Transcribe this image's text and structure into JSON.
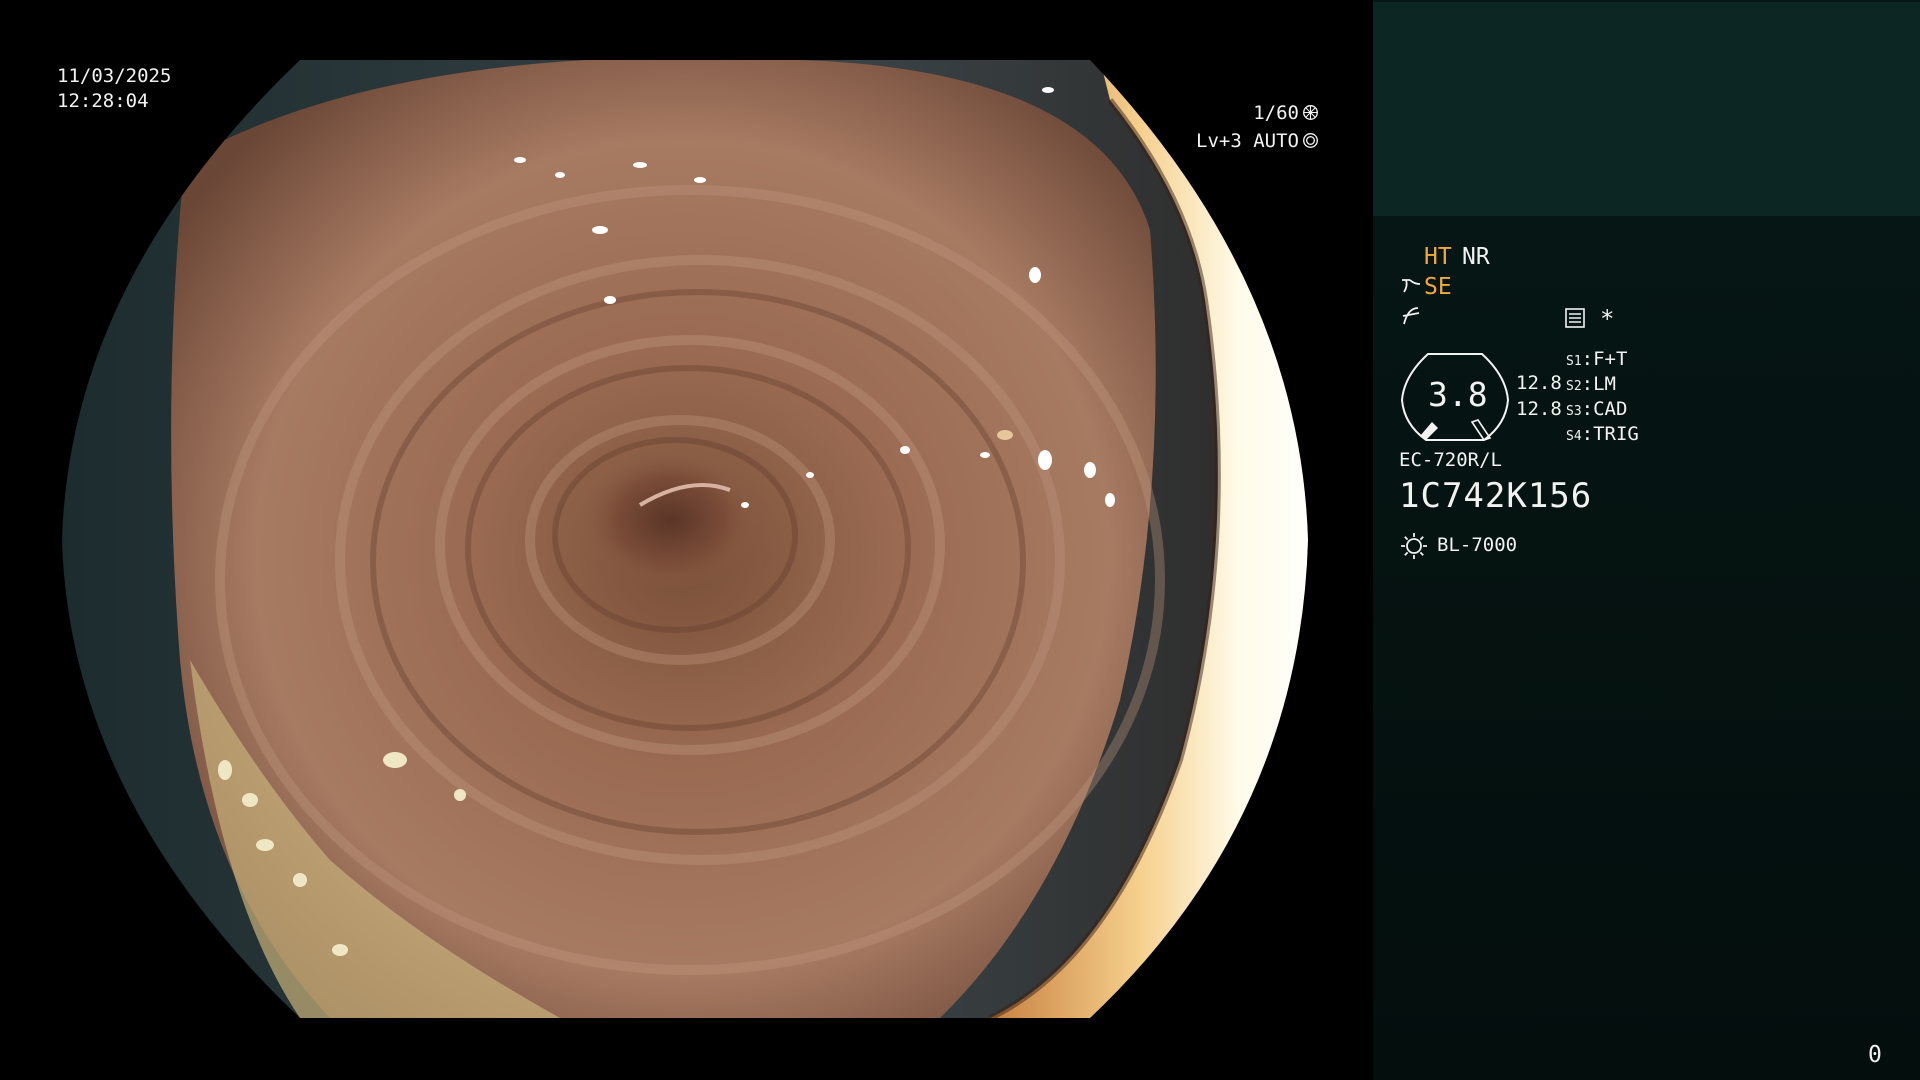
{
  "overlay": {
    "date": "11/03/2025",
    "time": "12:28:04",
    "shutter": "1/60",
    "level": "Lv+3 AUTO",
    "shutter_icon": "aperture-icon",
    "auto_icon": "iris-icon"
  },
  "panel": {
    "ht": "HT",
    "nr": "NR",
    "se": "SE",
    "se_icon": "structure-enhance-icon",
    "color_icon": "color-enhance-icon",
    "memo_icon": "memo-icon",
    "star": "*",
    "gauge_value": "3.8",
    "gauge_top": "12.8",
    "gauge_bottom": "12.8",
    "scope_buttons": [
      {
        "key": "S1",
        "label": ":F+T"
      },
      {
        "key": "S2",
        "label": ":LM"
      },
      {
        "key": "S3",
        "label": ":CAD"
      },
      {
        "key": "S4",
        "label": ":TRIG"
      }
    ],
    "scope_model": "EC-720R/L",
    "scope_serial": "1C742K156",
    "light_source_icon": "light-bulb-icon",
    "light_source": "BL-7000",
    "image_counter": "0"
  },
  "colors": {
    "accent_orange": "#f0a93a",
    "panel_top": "#0c2624",
    "panel_bg": "#051412"
  }
}
